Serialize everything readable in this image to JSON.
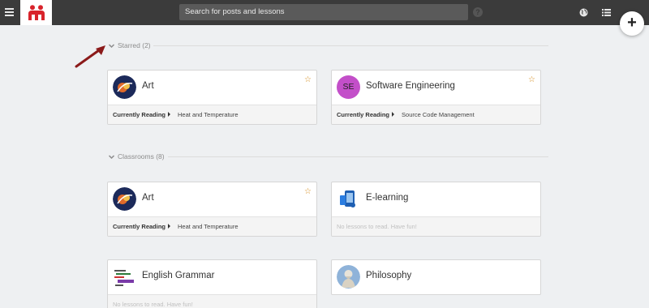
{
  "header": {
    "search_placeholder": "Search for posts and lessons",
    "help_label": "?",
    "fab_label": "+"
  },
  "sections": {
    "starred": {
      "label": "Starred (2)"
    },
    "classrooms": {
      "label": "Classrooms (8)"
    }
  },
  "starred_cards": [
    {
      "title": "Art",
      "currently_reading_label": "Currently Reading",
      "lesson": "Heat and Temperature",
      "icon": "art-thumbnail"
    },
    {
      "title": "Software Engineering",
      "avatar_text": "SE",
      "currently_reading_label": "Currently Reading",
      "lesson": "Source Code Management",
      "icon": "se-avatar"
    }
  ],
  "classroom_cards": [
    {
      "title": "Art",
      "currently_reading_label": "Currently Reading",
      "lesson": "Heat and Temperature",
      "icon": "art-thumbnail"
    },
    {
      "title": "E-learning",
      "empty_text": "No lessons to read. Have fun!",
      "icon": "elearning-thumbnail"
    },
    {
      "title": "English Grammar",
      "empty_text": "No lessons to read. Have fun!",
      "icon": "grammar-thumbnail"
    },
    {
      "title": "Philosophy",
      "icon": "philosophy-thumbnail"
    }
  ],
  "colors": {
    "topbar": "#3b3b3b",
    "brand": "#d8242c",
    "star": "#d48a1a",
    "annotation_arrow": "#8b1a1a",
    "se_avatar": "#c34fc9"
  }
}
